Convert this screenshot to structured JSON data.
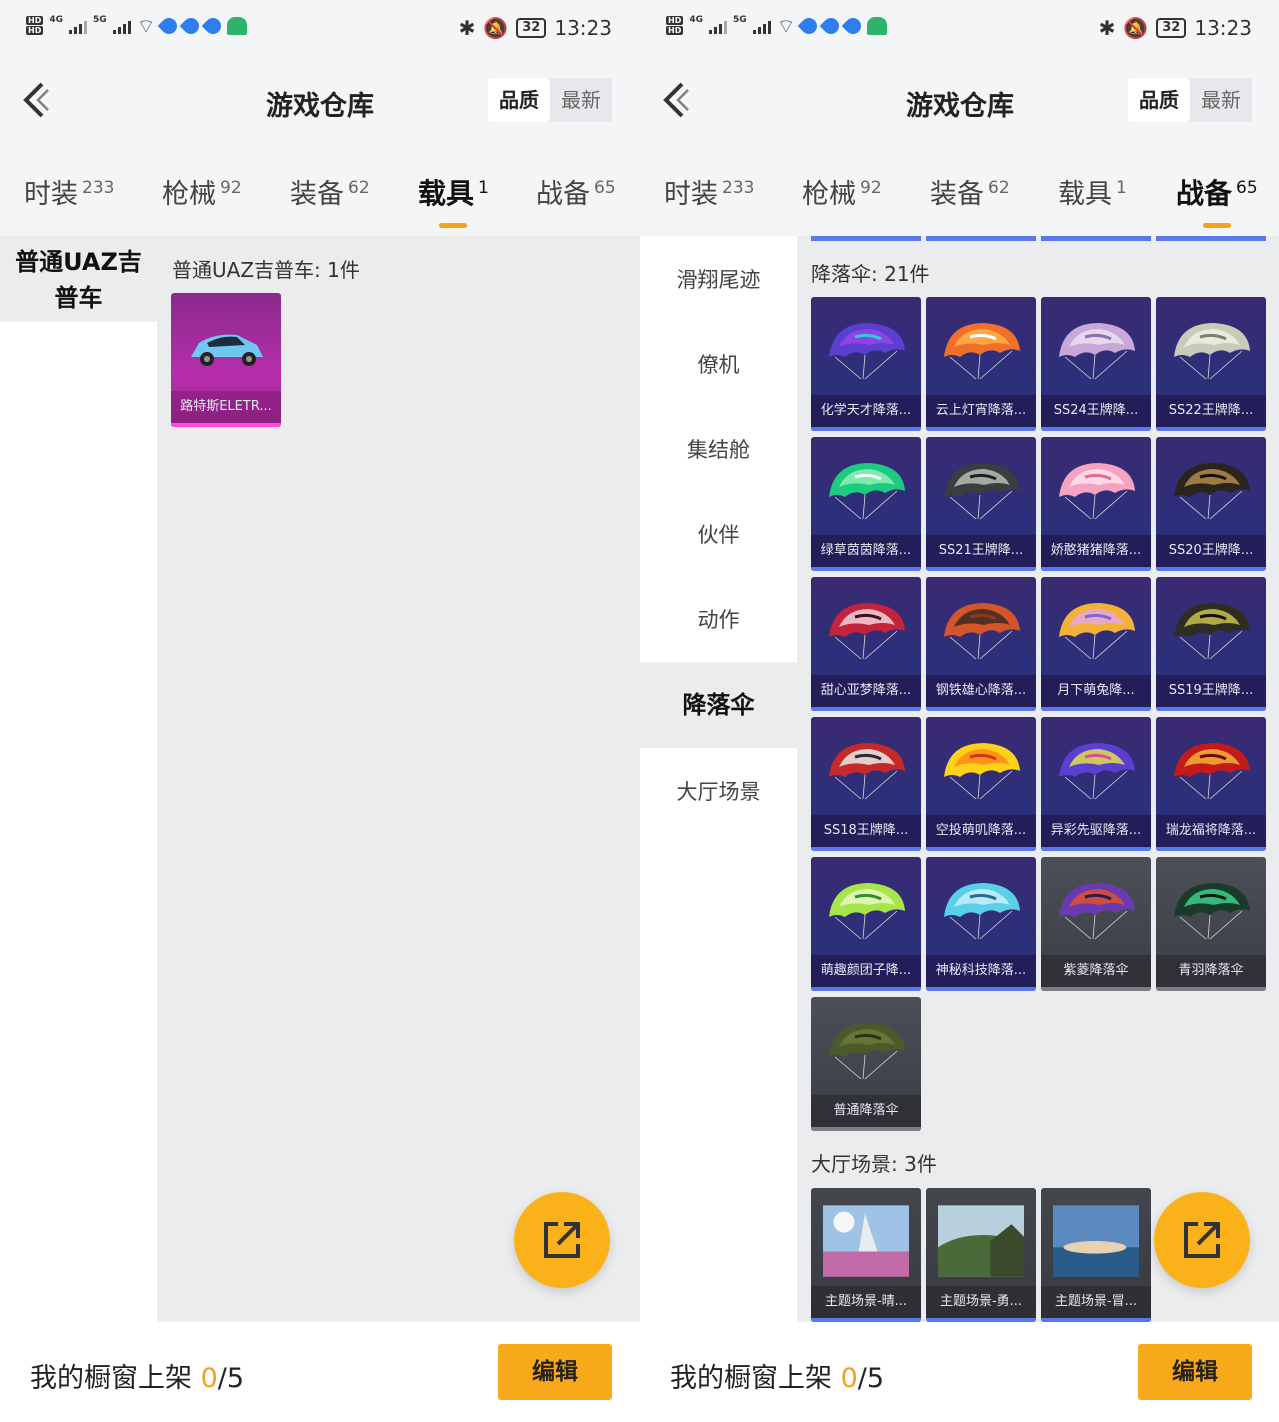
{
  "status_bar": {
    "time": "13:23",
    "battery": "32",
    "network_4g": "4G",
    "network_5g": "5G",
    "hd": "HD"
  },
  "header": {
    "back_icon": "chevron-left",
    "title": "游戏仓库",
    "sort_quality": "品质",
    "sort_newest": "最新"
  },
  "tabs": [
    {
      "label": "时装",
      "count": "233"
    },
    {
      "label": "枪械",
      "count": "92"
    },
    {
      "label": "装备",
      "count": "62"
    },
    {
      "label": "载具",
      "count": "1"
    },
    {
      "label": "战备",
      "count": "65"
    }
  ],
  "left_screen": {
    "active_tab": "载具",
    "sidebar": [
      {
        "label": "普通UAZ吉普车"
      }
    ],
    "section_title": "普通UAZ吉普车: 1件",
    "items": [
      {
        "label": "路特斯ELETR..."
      }
    ]
  },
  "right_screen": {
    "active_tab": "战备",
    "sidebar": [
      {
        "label": "滑翔尾迹"
      },
      {
        "label": "僚机"
      },
      {
        "label": "集结舱"
      },
      {
        "label": "伙伴"
      },
      {
        "label": "动作"
      },
      {
        "label": "降落伞"
      },
      {
        "label": "大厅场景"
      }
    ],
    "active_sidebar": "降落伞",
    "parachute_section": "降落伞: 21件",
    "parachutes": [
      {
        "label": "化学天才降落...",
        "colors": [
          "#5a3fd0",
          "#9a44e8",
          "#2ccbd6"
        ]
      },
      {
        "label": "云上灯宵降落...",
        "colors": [
          "#f0702a",
          "#ffb04a",
          "#ffffff"
        ]
      },
      {
        "label": "SS24王牌降...",
        "colors": [
          "#c9a7d8",
          "#e9e2ef",
          "#8a6fa8"
        ]
      },
      {
        "label": "SS22王牌降...",
        "colors": [
          "#c8cbb8",
          "#eef0e4",
          "#7c7f6c"
        ]
      },
      {
        "label": "绿草茵茵降落...",
        "colors": [
          "#1ec980",
          "#8ff0b8",
          "#ffffff"
        ]
      },
      {
        "label": "SS21王牌降...",
        "colors": [
          "#3b3e3e",
          "#b8bcb4",
          "#1f2121"
        ]
      },
      {
        "label": "娇憨猪猪降落...",
        "colors": [
          "#f5a3c0",
          "#ffe3ec",
          "#e06c95"
        ]
      },
      {
        "label": "SS20王牌降...",
        "colors": [
          "#2a241c",
          "#b58a4c",
          "#151210"
        ]
      },
      {
        "label": "甜心亚梦降落...",
        "colors": [
          "#c4233c",
          "#f2d4da",
          "#3a1016"
        ]
      },
      {
        "label": "钢铁雄心降落...",
        "colors": [
          "#d4552a",
          "#3a2a24",
          "#8a3a1c"
        ]
      },
      {
        "label": "月下萌兔降...",
        "colors": [
          "#f2b23a",
          "#e7a6e0",
          "#7a6ad0"
        ]
      },
      {
        "label": "SS19王牌降...",
        "colors": [
          "#2f2c22",
          "#c9c24a",
          "#111111"
        ]
      },
      {
        "label": "SS18王牌降...",
        "colors": [
          "#c42a2a",
          "#eaeaea",
          "#2a2a2a"
        ]
      },
      {
        "label": "空投萌叽降落...",
        "colors": [
          "#ffd21a",
          "#ff8a1a",
          "#d6321a"
        ]
      },
      {
        "label": "异彩先驱降落...",
        "colors": [
          "#5a3fd0",
          "#e0e04a",
          "#e04aa6"
        ]
      },
      {
        "label": "瑞龙福将降落...",
        "colors": [
          "#c41a1a",
          "#f2b23a",
          "#6a0a0a"
        ]
      },
      {
        "label": "萌趣颜团子降...",
        "colors": [
          "#a6e64a",
          "#e8f6c8",
          "#3a8a2a"
        ]
      },
      {
        "label": "神秘科技降落...",
        "colors": [
          "#5ad0e8",
          "#c8f0fa",
          "#2a6a8a"
        ]
      },
      {
        "label": "紫菱降落伞",
        "colors": [
          "#6a3ab0",
          "#e0502a",
          "#2a1a5a"
        ]
      },
      {
        "label": "青羽降落伞",
        "colors": [
          "#1a3a2a",
          "#3ad08a",
          "#0a1a12"
        ]
      },
      {
        "label": "普通降落伞",
        "colors": [
          "#4a5a2a",
          "#6a7a3a",
          "#2a3414"
        ]
      }
    ],
    "scene_section": "大厅场景: 3件",
    "scenes": [
      {
        "label": "主题场景-晴..."
      },
      {
        "label": "主题场景-勇..."
      },
      {
        "label": "主题场景-冒..."
      }
    ]
  },
  "fab_icon": "share-external",
  "bottom": {
    "window_label": "我的橱窗上架 ",
    "window_current": "0",
    "window_total": "/5",
    "edit_label": "编辑"
  },
  "colors": {
    "accent": "#f3a31b",
    "edit_button": "#f8a91b",
    "purple_card": "#2c2f7a",
    "pink_card": "#b42eaa"
  }
}
